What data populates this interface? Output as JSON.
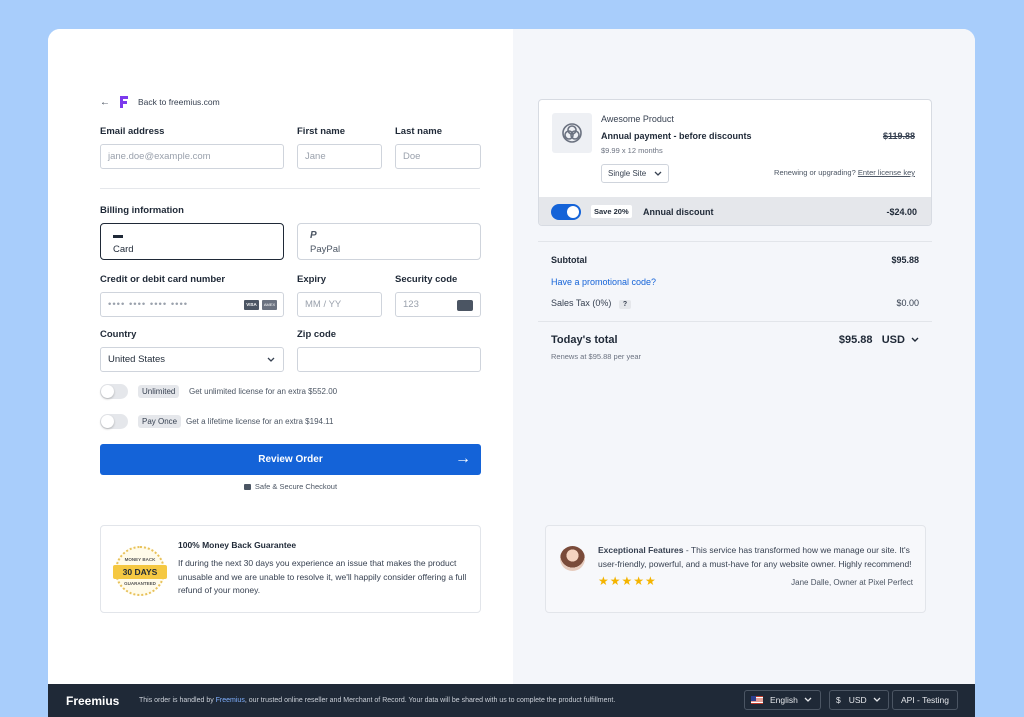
{
  "back": {
    "label": "Back to freemius.com"
  },
  "form": {
    "email_label": "Email address",
    "email_placeholder": "jane.doe@example.com",
    "first_name_label": "First name",
    "first_name_placeholder": "Jane",
    "last_name_label": "Last name",
    "last_name_placeholder": "Doe",
    "billing_label": "Billing information",
    "methods": [
      {
        "label": "Card",
        "selected": true
      },
      {
        "label": "PayPal",
        "selected": false
      }
    ],
    "card_label": "Credit or debit card number",
    "card_placeholder": "•••• •••• •••• ••••",
    "card_brands": [
      "VISA",
      "AMEX"
    ],
    "expiry_label": "Expiry",
    "expiry_placeholder": "MM / YY",
    "cvc_label": "Security code",
    "cvc_placeholder": "123",
    "country_label": "Country",
    "country_value": "United States",
    "zip_label": "Zip code",
    "zip_value": ""
  },
  "upsells": [
    {
      "badge": "Unlimited",
      "text": "Get unlimited license for an extra $552.00"
    },
    {
      "badge": "Pay Once",
      "text": "Get a lifetime license for an extra $194.11"
    }
  ],
  "review_button": "Review Order",
  "secure_text": "Safe & Secure Checkout",
  "guarantee": {
    "seal_top": "MONEY BACK",
    "seal_mid": "30 DAYS",
    "seal_bottom": "GUARANTEED",
    "title": "100% Money Back Guarantee",
    "body": "If during the next 30 days you experience an issue that makes the product unusable and we are unable to resolve it, we'll happily consider offering a full refund of your money."
  },
  "product": {
    "name": "Awesome Product",
    "plan": "Annual payment - before discounts",
    "detail": "$9.99 x 12 months",
    "old_price": "$119.88",
    "license_select": "Single Site",
    "renew_text": "Renewing or upgrading?",
    "renew_link": "Enter license key",
    "save_badge": "Save 20%",
    "discount_label": "Annual discount",
    "discount_value": "-$24.00"
  },
  "summary": {
    "subtotal_label": "Subtotal",
    "subtotal_value": "$95.88",
    "promo_link": "Have a promotional code?",
    "tax_label": "Sales Tax (0%)",
    "tax_help": "?",
    "tax_value": "$0.00",
    "total_label": "Today's total",
    "total_value": "$95.88",
    "total_currency": "USD",
    "renews": "Renews at $95.88 per year"
  },
  "testimonial": {
    "title": "Exceptional Features",
    "text": " - This service has transformed how we manage our site. It's user-friendly, powerful, and a must-have for any website owner. Highly recommend!",
    "stars": "★★★★★",
    "author": "Jane Dalle, Owner at Pixel Perfect"
  },
  "footer": {
    "logo": "Freemius",
    "text_pre": "This order is handled by ",
    "text_link": "Freemius",
    "text_post": ", our trusted online reseller and Merchant of Record. Your data will be shared with us to complete the product fulfillment.",
    "language": "English",
    "currency_symbol": "$",
    "currency": "USD",
    "mode": "API - Testing"
  },
  "colors": {
    "accent": "#1463d8",
    "page_bg": "#a8cdfb",
    "footer_bg": "#1f2937",
    "star": "#f4b400"
  }
}
